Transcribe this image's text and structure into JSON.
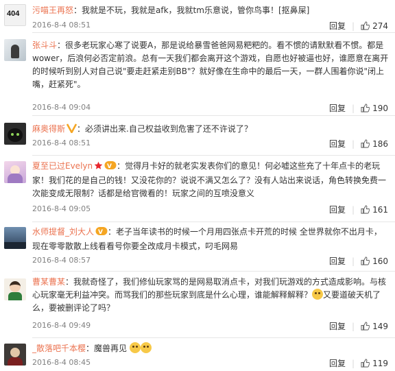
{
  "reply_label": "回复",
  "comments": [
    {
      "name": "污喵王再怒",
      "badges": [],
      "text": "我就是不玩，我就是afk，我就tm乐意说，管你鸟事！[抠鼻屎]",
      "time": "2016-8-4 08:51",
      "likes": "274",
      "avatar_text": "404"
    },
    {
      "name": "张斗斗",
      "badges": [],
      "text": "很多老玩家心寒了说要A，那是说给暴雪爸爸网易粑粑的。看不惯的请默默看不惯。都是wower，后浪何必否定前浪。总有一天我们都会离开这个游戏，自愿也好被逼也好，谁愿意在离开的时候听到别人对自己说\"要走赶紧走别BB\"？就好像在生命中的最后一天，一群人围着你说\"闭上嘴，赶紧死\"。",
      "time": "2016-8-4 09:04",
      "likes": "190"
    },
    {
      "name": "麻奥得斯",
      "badges": [
        "v-icon"
      ],
      "text": "必须讲出来.自己权益收到危害了还不许说了？",
      "time": "2016-8-4 08:51",
      "likes": "186"
    },
    {
      "name": "夏至已过Evelyn",
      "badges": [
        "star-icon",
        "vip-icon"
      ],
      "text": "觉得月卡好的就老实发表你们的意见！何必嘘这些充了十年点卡的老玩家！我们花的是自己的钱！又没花你的？说说不满又怎么了？没有人站出来说话，角色转换免费一次能变成无限制？话都是给官微看的！玩家之间的互喷没意义",
      "time": "2016-8-4 09:05",
      "likes": "161"
    },
    {
      "name": "水师提督_刘大人",
      "badges": [
        "vip-icon"
      ],
      "text": "老子当年读书的时候一个月用四张点卡开荒的时候 全世界就你不出月卡，现在零零散散上线看看号你要全改成月卡模式，叼毛网易",
      "time": "2016-8-4 08:57",
      "likes": "160"
    },
    {
      "name": "曹某曹某",
      "badges": [],
      "text": "我就奇怪了，我们修仙玩家骂的是网易取消点卡，对我们玩游戏的方式造成影响。与核心玩家毫无利益冲突。而骂我们的那些玩家到底是什么心理，谁能解释解释？",
      "text_tail": "又要道破天机了么，要被删评论了吗？",
      "time": "2016-8-4 09:49",
      "likes": "149"
    },
    {
      "name": "_散落吧千本樱",
      "badges": [],
      "text": "魔兽再见",
      "time": "2016-8-4 08:45",
      "likes": "119"
    }
  ]
}
